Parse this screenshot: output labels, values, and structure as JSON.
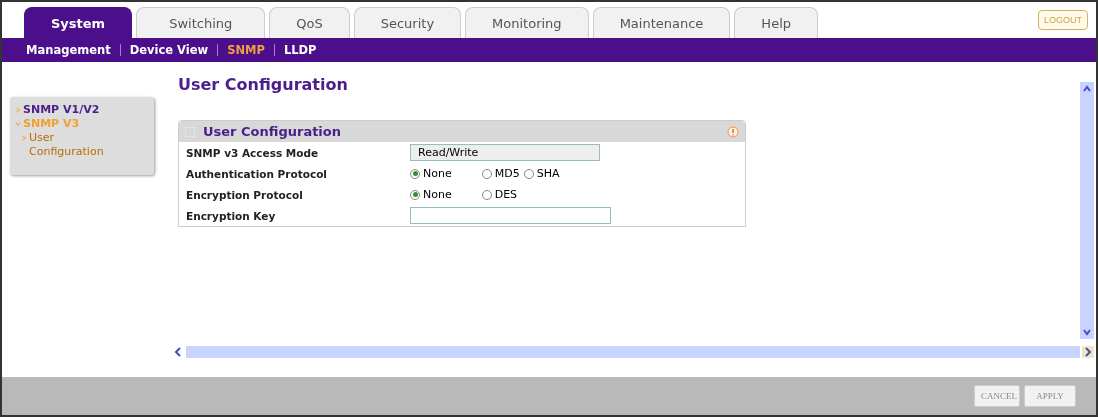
{
  "tabs": [
    {
      "label": "System",
      "selected": true
    },
    {
      "label": "Switching",
      "selected": false
    },
    {
      "label": "QoS",
      "selected": false
    },
    {
      "label": "Security",
      "selected": false
    },
    {
      "label": "Monitoring",
      "selected": false
    },
    {
      "label": "Maintenance",
      "selected": false
    },
    {
      "label": "Help",
      "selected": false
    }
  ],
  "logout": "LOGOUT",
  "subnav": [
    {
      "label": "Management",
      "selected": false
    },
    {
      "label": "Device View",
      "selected": false
    },
    {
      "label": "SNMP",
      "selected": true
    },
    {
      "label": "LLDP",
      "selected": false
    }
  ],
  "sidebar": {
    "items": [
      {
        "label": "SNMP V1/V2",
        "selected": false,
        "expanded": false
      },
      {
        "label": "SNMP V3",
        "selected": true,
        "expanded": true,
        "children": [
          {
            "label": "User Configuration",
            "selected": true
          }
        ]
      }
    ]
  },
  "page_title": "User Configuration",
  "panel": {
    "title": "User Configuration",
    "rows": [
      {
        "kind": "readonly",
        "label": "SNMP v3 Access Mode",
        "value": "Read/Write"
      },
      {
        "kind": "radio",
        "label": "Authentication Protocol",
        "options": [
          {
            "label": "None",
            "selected": true
          },
          {
            "label": "MD5",
            "selected": false
          },
          {
            "label": "SHA",
            "selected": false
          }
        ]
      },
      {
        "kind": "radio",
        "label": "Encryption Protocol",
        "options": [
          {
            "label": "None",
            "selected": true
          },
          {
            "label": "DES",
            "selected": false
          }
        ]
      },
      {
        "kind": "input",
        "label": "Encryption Key"
      }
    ]
  },
  "buttons": [
    "CANCEL",
    "APPLY"
  ]
}
